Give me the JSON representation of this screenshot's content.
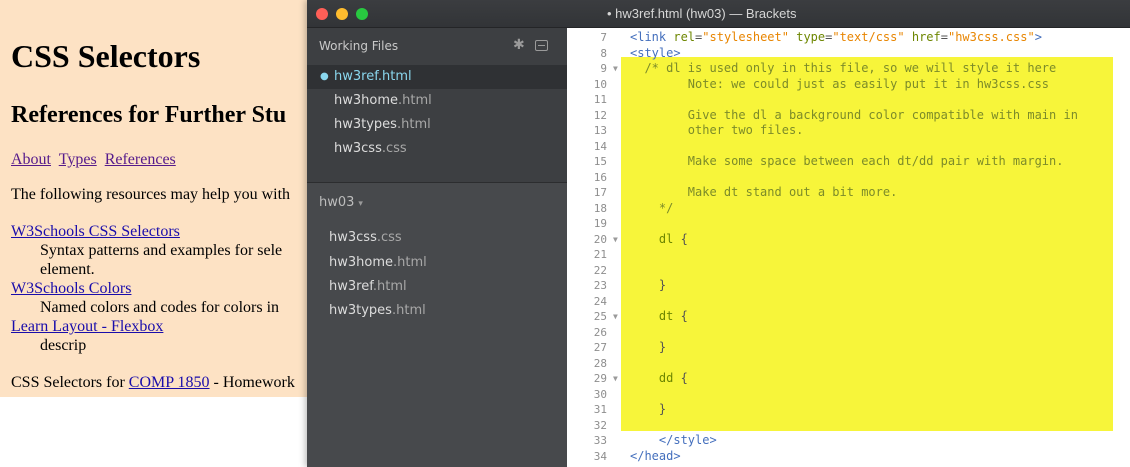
{
  "browser": {
    "heading": "CSS Selectors",
    "subheading": "References for Further Stu",
    "nav": [
      {
        "label": "About",
        "visited": true
      },
      {
        "label": "Types",
        "visited": true
      },
      {
        "label": "References",
        "visited": true
      }
    ],
    "intro": "The following resources may help you with",
    "resources": [
      {
        "term": "W3Schools CSS Selectors",
        "desc": "Syntax patterns and examples for sele element."
      },
      {
        "term": "W3Schools Colors",
        "desc": "Named colors and codes for colors in"
      },
      {
        "term": "Learn Layout - Flexbox",
        "desc": "descrip"
      }
    ],
    "footer_prefix": "CSS Selectors for ",
    "footer_link": "COMP 1850",
    "footer_suffix": " - Homework"
  },
  "window": {
    "title": "• hw3ref.html (hw03) — Brackets"
  },
  "sidebar": {
    "working_files_label": "Working Files",
    "working_files": [
      {
        "name": "hw3ref",
        "ext": ".html",
        "active": true
      },
      {
        "name": "hw3home",
        "ext": ".html",
        "active": false
      },
      {
        "name": "hw3types",
        "ext": ".html",
        "active": false
      },
      {
        "name": "hw3css",
        "ext": ".css",
        "active": false
      }
    ],
    "project_name": "hw03",
    "project_caret": "▾",
    "project_files": [
      {
        "name": "hw3css",
        "ext": ".css"
      },
      {
        "name": "hw3home",
        "ext": ".html"
      },
      {
        "name": "hw3ref",
        "ext": ".html"
      },
      {
        "name": "hw3types",
        "ext": ".html"
      }
    ]
  },
  "code": {
    "lines": [
      {
        "n": "7",
        "fold": false,
        "parts": [
          [
            "tag",
            "<link "
          ],
          [
            "attr",
            "rel"
          ],
          [
            "punc",
            "="
          ],
          [
            "str",
            "\"stylesheet\""
          ],
          [
            "punc",
            " "
          ],
          [
            "attr",
            "type"
          ],
          [
            "punc",
            "="
          ],
          [
            "str",
            "\"text/css\""
          ],
          [
            "punc",
            " "
          ],
          [
            "attr",
            "href"
          ],
          [
            "punc",
            "="
          ],
          [
            "str",
            "\"hw3css.css\""
          ],
          [
            "tag",
            ">"
          ]
        ]
      },
      {
        "n": "8",
        "fold": false,
        "parts": [
          [
            "tag",
            "<style>"
          ]
        ]
      },
      {
        "n": "9",
        "fold": true,
        "parts": [
          [
            "comment",
            "  /* dl is used only in this file, so we will style it here"
          ]
        ]
      },
      {
        "n": "10",
        "fold": false,
        "parts": [
          [
            "comment",
            "        Note: we could just as easily put it in hw3css.css"
          ]
        ]
      },
      {
        "n": "11",
        "fold": false,
        "parts": [
          [
            "comment",
            ""
          ]
        ]
      },
      {
        "n": "12",
        "fold": false,
        "parts": [
          [
            "comment",
            "        Give the dl a background color compatible with main in"
          ]
        ]
      },
      {
        "n": "13",
        "fold": false,
        "parts": [
          [
            "comment",
            "        other two files."
          ]
        ]
      },
      {
        "n": "14",
        "fold": false,
        "parts": [
          [
            "comment",
            ""
          ]
        ]
      },
      {
        "n": "15",
        "fold": false,
        "parts": [
          [
            "comment",
            "        Make some space between each dt/dd pair with margin."
          ]
        ]
      },
      {
        "n": "16",
        "fold": false,
        "parts": [
          [
            "comment",
            ""
          ]
        ]
      },
      {
        "n": "17",
        "fold": false,
        "parts": [
          [
            "comment",
            "        Make dt stand out a bit more."
          ]
        ]
      },
      {
        "n": "18",
        "fold": false,
        "parts": [
          [
            "comment",
            "    */"
          ]
        ]
      },
      {
        "n": "19",
        "fold": false,
        "parts": [
          [
            "punc",
            ""
          ]
        ]
      },
      {
        "n": "20",
        "fold": true,
        "parts": [
          [
            "sel",
            "    dl "
          ],
          [
            "punc",
            "{"
          ]
        ]
      },
      {
        "n": "21",
        "fold": false,
        "parts": [
          [
            "punc",
            ""
          ]
        ]
      },
      {
        "n": "22",
        "fold": false,
        "parts": [
          [
            "punc",
            ""
          ]
        ]
      },
      {
        "n": "23",
        "fold": false,
        "parts": [
          [
            "punc",
            "    }"
          ]
        ]
      },
      {
        "n": "24",
        "fold": false,
        "parts": [
          [
            "punc",
            ""
          ]
        ]
      },
      {
        "n": "25",
        "fold": true,
        "parts": [
          [
            "sel",
            "    dt "
          ],
          [
            "punc",
            "{"
          ]
        ]
      },
      {
        "n": "26",
        "fold": false,
        "parts": [
          [
            "punc",
            ""
          ]
        ]
      },
      {
        "n": "27",
        "fold": false,
        "parts": [
          [
            "punc",
            "    }"
          ]
        ]
      },
      {
        "n": "28",
        "fold": false,
        "parts": [
          [
            "punc",
            ""
          ]
        ]
      },
      {
        "n": "29",
        "fold": true,
        "parts": [
          [
            "sel",
            "    dd "
          ],
          [
            "punc",
            "{"
          ]
        ]
      },
      {
        "n": "30",
        "fold": false,
        "parts": [
          [
            "punc",
            ""
          ]
        ]
      },
      {
        "n": "31",
        "fold": false,
        "parts": [
          [
            "punc",
            "    }"
          ]
        ]
      },
      {
        "n": "32",
        "fold": false,
        "parts": [
          [
            "punc",
            ""
          ]
        ]
      },
      {
        "n": "33",
        "fold": false,
        "parts": [
          [
            "punc",
            "    "
          ],
          [
            "tag",
            "</style>"
          ]
        ]
      },
      {
        "n": "34",
        "fold": false,
        "parts": [
          [
            "tag",
            "</head>"
          ]
        ]
      }
    ]
  }
}
